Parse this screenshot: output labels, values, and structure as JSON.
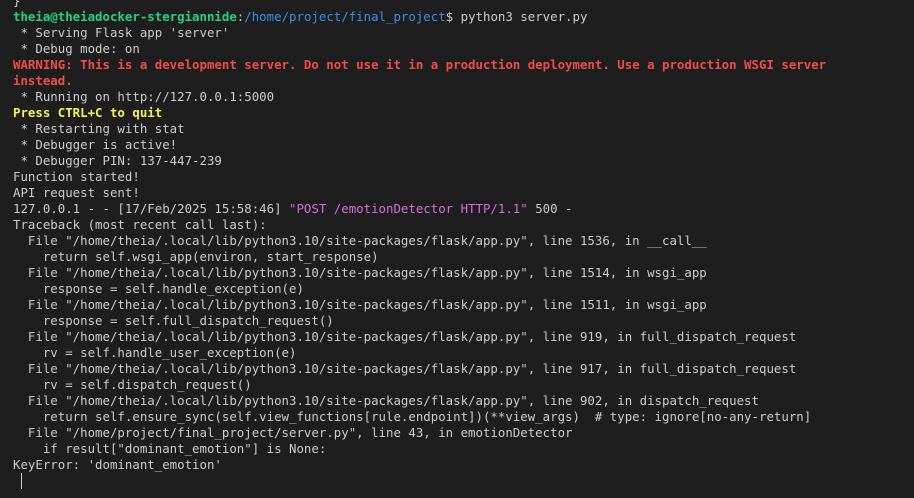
{
  "terminal": {
    "prev_line": "}",
    "prompt": {
      "user_host": "theia@theiadocker-stergiannide",
      "separator": ":",
      "path": "/home/project/final_project",
      "symbol": "$",
      "command": " python3 server.py"
    },
    "lines": {
      "serving": " * Serving Flask app 'server'",
      "debug_mode": " * Debug mode: on",
      "warning": "WARNING: This is a development server. Do not use it in a production deployment. Use a production WSGI server instead.",
      "running": " * Running on http://127.0.0.1:5000",
      "press": "Press CTRL+C to quit",
      "restarting": " * Restarting with stat",
      "debugger_active": " * Debugger is active!",
      "debugger_pin": " * Debugger PIN: 137-447-239",
      "function_started": "Function started!",
      "api_sent": "API request sent!",
      "log_prefix": "127.0.0.1 - - [17/Feb/2025 15:58:46] ",
      "log_request": "\"POST /emotionDetector HTTP/1.1\"",
      "log_suffix": " 500 -",
      "traceback": "Traceback (most recent call last):",
      "tb1_file": "  File \"/home/theia/.local/lib/python3.10/site-packages/flask/app.py\", line 1536, in __call__",
      "tb1_code": "    return self.wsgi_app(environ, start_response)",
      "tb2_file": "  File \"/home/theia/.local/lib/python3.10/site-packages/flask/app.py\", line 1514, in wsgi_app",
      "tb2_code": "    response = self.handle_exception(e)",
      "tb3_file": "  File \"/home/theia/.local/lib/python3.10/site-packages/flask/app.py\", line 1511, in wsgi_app",
      "tb3_code": "    response = self.full_dispatch_request()",
      "tb4_file": "  File \"/home/theia/.local/lib/python3.10/site-packages/flask/app.py\", line 919, in full_dispatch_request",
      "tb4_code": "    rv = self.handle_user_exception(e)",
      "tb5_file": "  File \"/home/theia/.local/lib/python3.10/site-packages/flask/app.py\", line 917, in full_dispatch_request",
      "tb5_code": "    rv = self.dispatch_request()",
      "tb6_file": "  File \"/home/theia/.local/lib/python3.10/site-packages/flask/app.py\", line 902, in dispatch_request",
      "tb6_code": "    return self.ensure_sync(self.view_functions[rule.endpoint])(**view_args)  # type: ignore[no-any-return]",
      "tb7_file": "  File \"/home/project/final_project/server.py\", line 43, in emotionDetector",
      "tb7_code": "    if result[\"dominant_emotion\"] is None:",
      "error": "KeyError: 'dominant_emotion'"
    }
  },
  "colors": {
    "background": "#1e1e1e",
    "text": "#cccccc",
    "prompt_user": "#23d18b",
    "prompt_path": "#3b8eea",
    "warning": "#f14c4c",
    "press_quit": "#f5f543",
    "request": "#d670d6"
  }
}
